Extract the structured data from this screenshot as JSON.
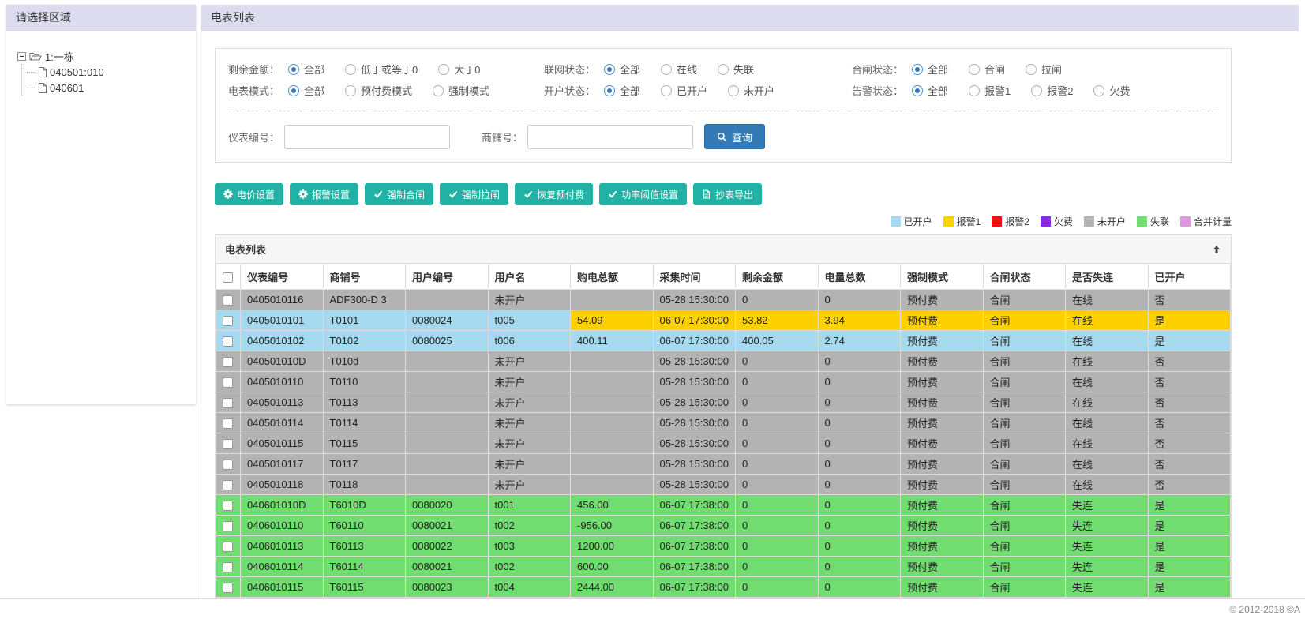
{
  "theme": {
    "header_lavender": "#dcdcee",
    "accent_teal": "#22b1a5",
    "primary_blue": "#337ab7"
  },
  "sidebar": {
    "title": "请选择区域",
    "tree": {
      "root_label": "1:一栋",
      "children": [
        "040501:010",
        "040601"
      ]
    }
  },
  "main": {
    "title": "电表列表",
    "filters": {
      "groups": [
        [
          {
            "label": "剩余金额：",
            "options": [
              "全部",
              "低于或等于0",
              "大于0"
            ],
            "selected": 0
          },
          {
            "label": "联网状态：",
            "options": [
              "全部",
              "在线",
              "失联"
            ],
            "selected": 0
          },
          {
            "label": "合闸状态：",
            "options": [
              "全部",
              "合闸",
              "拉闸"
            ],
            "selected": 0
          }
        ],
        [
          {
            "label": "电表模式：",
            "options": [
              "全部",
              "预付费模式",
              "强制模式"
            ],
            "selected": 0
          },
          {
            "label": "开户状态：",
            "options": [
              "全部",
              "已开户",
              "未开户"
            ],
            "selected": 0
          },
          {
            "label": "告警状态：",
            "options": [
              "全部",
              "报警1",
              "报警2",
              "欠费"
            ],
            "selected": 0
          }
        ]
      ],
      "meter_label": "仪表编号：",
      "meter_value": "",
      "shop_label": "商铺号：",
      "shop_value": "",
      "search_button": "查询"
    },
    "toolbar": [
      {
        "name": "price-settings-button",
        "icon": "gear-icon",
        "label": "电价设置"
      },
      {
        "name": "alarm-settings-button",
        "icon": "gear-icon",
        "label": "报警设置"
      },
      {
        "name": "force-close-button",
        "icon": "check-icon",
        "label": "强制合闸"
      },
      {
        "name": "force-trip-button",
        "icon": "check-icon",
        "label": "强制拉闸"
      },
      {
        "name": "restore-prepaid-button",
        "icon": "check-icon",
        "label": "恢复预付费"
      },
      {
        "name": "power-threshold-button",
        "icon": "check-icon",
        "label": "功率阈值设置"
      },
      {
        "name": "meter-export-button",
        "icon": "file-icon",
        "label": "抄表导出"
      }
    ],
    "legend": [
      {
        "label": "已开户",
        "color": "#a6d9ee"
      },
      {
        "label": "报警1",
        "color": "#ffd000"
      },
      {
        "label": "报警2",
        "color": "#ee1111"
      },
      {
        "label": "欠费",
        "color": "#8a2be2"
      },
      {
        "label": "未开户",
        "color": "#b3b3b3"
      },
      {
        "label": "失联",
        "color": "#71dd71"
      },
      {
        "label": "合并计量",
        "color": "#dd99dd"
      }
    ],
    "table": {
      "title": "电表列表",
      "columns": [
        "仪表编号",
        "商铺号",
        "用户编号",
        "用户名",
        "购电总额",
        "采集时间",
        "剩余金额",
        "电量总数",
        "强制模式",
        "合闸状态",
        "是否失连",
        "已开户"
      ],
      "status_colors": {
        "gray": "#b3b3b3",
        "blue": "#a6d9ee",
        "yellow": "#ffd000",
        "green": "#71dd71"
      },
      "rows": [
        {
          "status": "gray",
          "cells": [
            "0405010116",
            "ADF300-D 3",
            "",
            "未开户",
            "",
            "05-28 15:30:00",
            "0",
            "0",
            "预付费",
            "合闸",
            "在线",
            "否"
          ]
        },
        {
          "status": "blue",
          "alert_from": 4,
          "alert_status": "yellow",
          "cells": [
            "0405010101",
            "T0101",
            "0080024",
            "t005",
            "54.09",
            "06-07 17:30:00",
            "53.82",
            "3.94",
            "预付费",
            "合闸",
            "在线",
            "是"
          ]
        },
        {
          "status": "blue",
          "cells": [
            "0405010102",
            "T0102",
            "0080025",
            "t006",
            "400.11",
            "06-07 17:30:00",
            "400.05",
            "2.74",
            "预付费",
            "合闸",
            "在线",
            "是"
          ]
        },
        {
          "status": "gray",
          "cells": [
            "040501010D",
            "T010d",
            "",
            "未开户",
            "",
            "05-28 15:30:00",
            "0",
            "0",
            "预付费",
            "合闸",
            "在线",
            "否"
          ]
        },
        {
          "status": "gray",
          "cells": [
            "0405010110",
            "T0110",
            "",
            "未开户",
            "",
            "05-28 15:30:00",
            "0",
            "0",
            "预付费",
            "合闸",
            "在线",
            "否"
          ]
        },
        {
          "status": "gray",
          "cells": [
            "0405010113",
            "T0113",
            "",
            "未开户",
            "",
            "05-28 15:30:00",
            "0",
            "0",
            "预付费",
            "合闸",
            "在线",
            "否"
          ]
        },
        {
          "status": "gray",
          "cells": [
            "0405010114",
            "T0114",
            "",
            "未开户",
            "",
            "05-28 15:30:00",
            "0",
            "0",
            "预付费",
            "合闸",
            "在线",
            "否"
          ]
        },
        {
          "status": "gray",
          "cells": [
            "0405010115",
            "T0115",
            "",
            "未开户",
            "",
            "05-28 15:30:00",
            "0",
            "0",
            "预付费",
            "合闸",
            "在线",
            "否"
          ]
        },
        {
          "status": "gray",
          "cells": [
            "0405010117",
            "T0117",
            "",
            "未开户",
            "",
            "05-28 15:30:00",
            "0",
            "0",
            "预付费",
            "合闸",
            "在线",
            "否"
          ]
        },
        {
          "status": "gray",
          "cells": [
            "0405010118",
            "T0118",
            "",
            "未开户",
            "",
            "05-28 15:30:00",
            "0",
            "0",
            "预付费",
            "合闸",
            "在线",
            "否"
          ]
        },
        {
          "status": "green",
          "cells": [
            "040601010D",
            "T6010D",
            "0080020",
            "t001",
            "456.00",
            "06-07 17:38:00",
            "0",
            "0",
            "预付费",
            "合闸",
            "失连",
            "是"
          ]
        },
        {
          "status": "green",
          "cells": [
            "0406010110",
            "T60110",
            "0080021",
            "t002",
            "-956.00",
            "06-07 17:38:00",
            "0",
            "0",
            "预付费",
            "合闸",
            "失连",
            "是"
          ]
        },
        {
          "status": "green",
          "cells": [
            "0406010113",
            "T60113",
            "0080022",
            "t003",
            "1200.00",
            "06-07 17:38:00",
            "0",
            "0",
            "预付费",
            "合闸",
            "失连",
            "是"
          ]
        },
        {
          "status": "green",
          "cells": [
            "0406010114",
            "T60114",
            "0080021",
            "t002",
            "600.00",
            "06-07 17:38:00",
            "0",
            "0",
            "预付费",
            "合闸",
            "失连",
            "是"
          ]
        },
        {
          "status": "green",
          "cells": [
            "0406010115",
            "T60115",
            "0080023",
            "t004",
            "2444.00",
            "06-07 17:38:00",
            "0",
            "0",
            "预付费",
            "合闸",
            "失连",
            "是"
          ]
        }
      ]
    }
  },
  "footer": {
    "copyright": "© 2012-2018 ©A"
  }
}
